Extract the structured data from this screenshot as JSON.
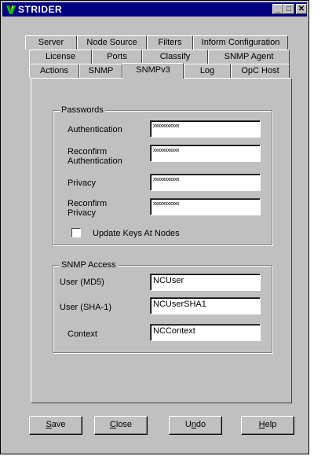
{
  "window": {
    "title": "STRIDER"
  },
  "titlebar": {
    "minimize": "_",
    "maximize": "□",
    "close": "✕"
  },
  "tabs": {
    "row1": [
      "Server",
      "Node Source",
      "Filters",
      "Inform Configuration"
    ],
    "row2": [
      "License",
      "Ports",
      "Classify",
      "SNMP Agent"
    ],
    "row3": [
      "Actions",
      "SNMP",
      "SNMPv3",
      "Log",
      "OpC Host"
    ],
    "active": "SNMPv3"
  },
  "passwords": {
    "title": "Passwords",
    "authentication_label": "Authentication",
    "reconfirm_auth_label_1": "Reconfirm",
    "reconfirm_auth_label_2": "Authentication",
    "privacy_label": "Privacy",
    "reconfirm_priv_label_1": "Reconfirm",
    "reconfirm_priv_label_2": "Privacy",
    "authentication_value": "xxxxxxxxxxx",
    "reconfirm_auth_value": "xxxxxxxxxxx",
    "privacy_value": "xxxxxxxxxxx",
    "reconfirm_priv_value": "xxxxxxxxxxx",
    "update_keys_label": "Update Keys At Nodes",
    "update_keys_checked": false
  },
  "snmp_access": {
    "title": "SNMP Access",
    "user_md5_label": "User (MD5)",
    "user_md5_value": "NCUser",
    "user_sha1_label": "User (SHA-1)",
    "user_sha1_value": "NCUserSHA1",
    "context_label": "Context",
    "context_value": "NCContext"
  },
  "buttons": {
    "save_u": "S",
    "save_rest": "ave",
    "close_u": "C",
    "close_rest": "lose",
    "undo_pre": "U",
    "undo_u": "n",
    "undo_rest": "do",
    "help_u": "H",
    "help_rest": "elp"
  }
}
